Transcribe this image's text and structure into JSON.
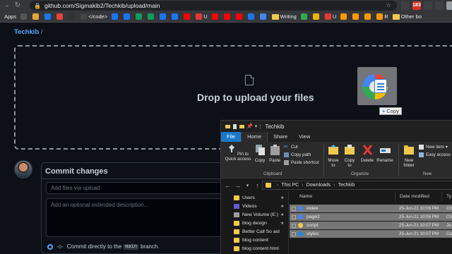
{
  "browser": {
    "url": "github.com/Sigmakib2/Techkib/upload/main",
    "bookmarks": [
      {
        "label": "Apps",
        "kind": "text"
      },
      {
        "label": "",
        "kind": "icon",
        "color": "#555"
      },
      {
        "label": "",
        "kind": "icon",
        "color": "#e8a33d"
      },
      {
        "label": "",
        "kind": "icon",
        "color": "#1877f2"
      },
      {
        "label": "",
        "kind": "icon",
        "color": "#ea4335"
      },
      {
        "label": "",
        "kind": "icon",
        "color": "#333"
      },
      {
        "label": "</code>",
        "kind": "iconlabel",
        "color": "#444"
      },
      {
        "label": "",
        "kind": "icon",
        "color": "#1877f2"
      },
      {
        "label": "",
        "kind": "icon",
        "color": "#1877f2"
      },
      {
        "label": "",
        "kind": "icon",
        "color": "#0f9d58"
      },
      {
        "label": "",
        "kind": "icon",
        "color": "#0f9d58"
      },
      {
        "label": "",
        "kind": "icon",
        "color": "#1877f2"
      },
      {
        "label": "",
        "kind": "icon",
        "color": "#1877f2"
      },
      {
        "label": "",
        "kind": "icon",
        "color": "#ff0000"
      },
      {
        "label": "U",
        "kind": "iconlabel",
        "color": "#e53935"
      },
      {
        "label": "",
        "kind": "icon",
        "color": "#ff0000"
      },
      {
        "label": "",
        "kind": "icon",
        "color": "#ff0000"
      },
      {
        "label": "",
        "kind": "icon",
        "color": "#ff0000"
      },
      {
        "label": "",
        "kind": "icon",
        "color": "#1877f2"
      },
      {
        "label": "",
        "kind": "icon",
        "color": "#4285f4"
      },
      {
        "label": "Writing",
        "kind": "folder"
      },
      {
        "label": "",
        "kind": "icon",
        "color": "#34a853"
      },
      {
        "label": "",
        "kind": "icon",
        "color": "#f4b400"
      },
      {
        "label": "U",
        "kind": "iconlabel",
        "color": "#e53935"
      },
      {
        "label": "",
        "kind": "icon",
        "color": "#ff9900"
      },
      {
        "label": "",
        "kind": "icon",
        "color": "#ff9900"
      },
      {
        "label": "",
        "kind": "icon",
        "color": "#ff9900"
      },
      {
        "label": "R",
        "kind": "iconlabel",
        "color": "#ff9900"
      },
      {
        "label": "Other bo",
        "kind": "folder"
      }
    ],
    "extensions": [
      {
        "color": "#3c4043",
        "text": ""
      },
      {
        "color": "#d93025",
        "text": "183"
      },
      {
        "color": "#3c4043",
        "text": ""
      },
      {
        "color": "#3c4043",
        "text": ""
      },
      {
        "color": "#9aa0a6",
        "text": ""
      }
    ]
  },
  "github": {
    "repo": "Techkib",
    "separator": "/",
    "drop_title": "Drop to upload your files",
    "drag_tooltip": "Copy",
    "drag_tooltip_plus": "+",
    "commit": {
      "title": "Commit changes",
      "summary_placeholder": "Add files via upload",
      "description_placeholder": "Add an optional extended description...",
      "radio_prefix": "Commit directly to the",
      "branch": "main",
      "radio_suffix": "branch."
    }
  },
  "explorer": {
    "title": "Techkib",
    "tabs": [
      "File",
      "Home",
      "Share",
      "View"
    ],
    "ribbon": {
      "pin": "Pin to Quick access",
      "copy": "Copy",
      "paste": "Paste",
      "cut": "Cut",
      "copy_path": "Copy path",
      "paste_shortcut": "Paste shortcut",
      "clipboard": "Clipboard",
      "move_to": "Move to",
      "copy_to": "Copy to",
      "delete": "Delete",
      "rename": "Rename",
      "organize": "Organize",
      "new_folder": "New folder",
      "new_item": "New item",
      "easy_access": "Easy access",
      "new": "New"
    },
    "path": [
      "This PC",
      "Downloads",
      "Techkib"
    ],
    "nav_items": [
      {
        "label": "Users",
        "color": "#f2c94c",
        "pinned": true
      },
      {
        "label": "Videos",
        "color": "#6a5acd",
        "pinned": true
      },
      {
        "label": "New Volume (E:)",
        "color": "#9e9e9e",
        "pinned": true
      },
      {
        "label": "blog design",
        "color": "#f2c94c",
        "pinned": true
      },
      {
        "label": "Better Call So aul",
        "color": "#f2c94c",
        "pinned": false
      },
      {
        "label": "blog content",
        "color": "#f2c94c",
        "pinned": false
      },
      {
        "label": "blog content html",
        "color": "#f2c94c",
        "pinned": false
      }
    ],
    "columns": [
      "Name",
      "Date modified",
      "Ty"
    ],
    "files": [
      {
        "name": "index",
        "date": "25-Jun-21 10:06 PM",
        "type": "Ch",
        "selected": true,
        "icon_color": "#4285f4"
      },
      {
        "name": "page2",
        "date": "25-Jun-21 10:06 PM",
        "type": "Ch",
        "selected": true,
        "icon_color": "#4285f4"
      },
      {
        "name": "script",
        "date": "25-Jun-21 10:07 PM",
        "type": "Ja",
        "selected": true,
        "icon_color": "#f2c94c"
      },
      {
        "name": "styles",
        "date": "25-Jun-21 10:07 PM",
        "type": "Ca",
        "selected": true,
        "icon_color": "#1e88e5"
      }
    ]
  }
}
